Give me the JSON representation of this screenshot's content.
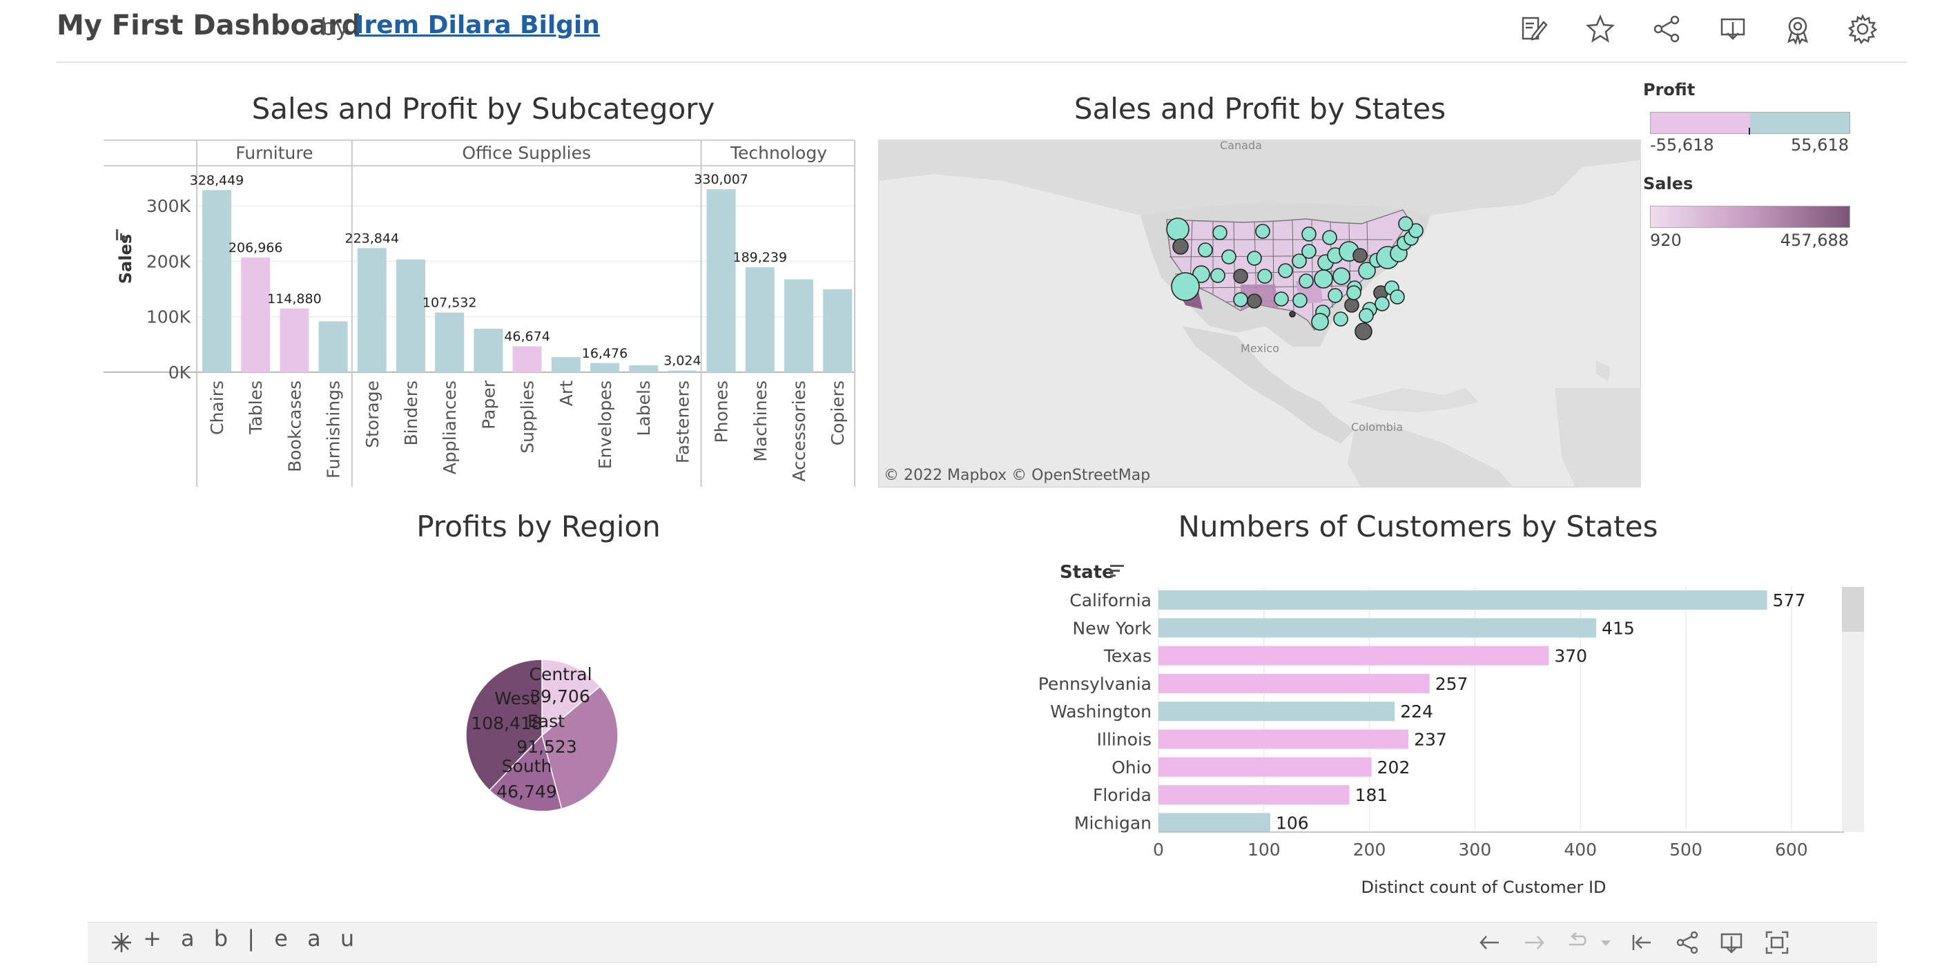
{
  "header": {
    "title": "My First Dashboard",
    "by": "by",
    "author": "Irem Dilara Bilgin",
    "icons": [
      "edit-icon",
      "star-icon",
      "share-icon",
      "download-icon",
      "metrics-icon",
      "settings-icon"
    ]
  },
  "colors": {
    "teal": "#b7d3da",
    "pink": "#e8c4e8",
    "bright_pink": "#eeb8ea",
    "mauve": "#8a5d86",
    "dark_mauve": "#6e3d68",
    "mint": "#8ee3cf"
  },
  "subcategory_chart": {
    "title": "Sales and Profit by Subcategory",
    "ylabel": "Sales",
    "yticks": [
      "300K",
      "200K",
      "100K",
      "0K"
    ],
    "groups": [
      {
        "name": "Furniture",
        "bars": [
          {
            "label": "Chairs",
            "value": 328449,
            "text": "328,449",
            "color": "teal"
          },
          {
            "label": "Tables",
            "value": 206966,
            "text": "206,966",
            "color": "pink"
          },
          {
            "label": "Bookcases",
            "value": 114880,
            "text": "114,880",
            "color": "pink"
          },
          {
            "label": "Furnishings",
            "value": 91705,
            "text": "",
            "color": "teal"
          }
        ]
      },
      {
        "name": "Office Supplies",
        "bars": [
          {
            "label": "Storage",
            "value": 223844,
            "text": "223,844",
            "color": "teal"
          },
          {
            "label": "Binders",
            "value": 203413,
            "text": "",
            "color": "teal"
          },
          {
            "label": "Appliances",
            "value": 107532,
            "text": "107,532",
            "color": "teal"
          },
          {
            "label": "Paper",
            "value": 78479,
            "text": "",
            "color": "teal"
          },
          {
            "label": "Supplies",
            "value": 46674,
            "text": "46,674",
            "color": "pink"
          },
          {
            "label": "Art",
            "value": 27119,
            "text": "",
            "color": "teal"
          },
          {
            "label": "Envelopes",
            "value": 16476,
            "text": "16,476",
            "color": "teal"
          },
          {
            "label": "Labels",
            "value": 12486,
            "text": "",
            "color": "teal"
          },
          {
            "label": "Fasteners",
            "value": 3024,
            "text": "3,024",
            "color": "teal"
          }
        ]
      },
      {
        "name": "Technology",
        "bars": [
          {
            "label": "Phones",
            "value": 330007,
            "text": "330,007",
            "color": "teal"
          },
          {
            "label": "Machines",
            "value": 189239,
            "text": "189,239",
            "color": "teal"
          },
          {
            "label": "Accessories",
            "value": 167380,
            "text": "",
            "color": "teal"
          },
          {
            "label": "Copiers",
            "value": 149528,
            "text": "",
            "color": "teal"
          }
        ]
      }
    ]
  },
  "map_chart": {
    "title": "Sales and Profit by States",
    "labels": {
      "canada": "Canada",
      "mexico": "Mexico",
      "colombia": "Colombia"
    },
    "attribution": "© 2022 Mapbox  © OpenStreetMap"
  },
  "legend": {
    "profit_title": "Profit",
    "profit_min": "-55,618",
    "profit_max": "55,618",
    "sales_title": "Sales",
    "sales_min": "920",
    "sales_max": "457,688"
  },
  "pie_chart": {
    "title": "Profits by Region",
    "slices": [
      {
        "region": "Central",
        "value": 39706,
        "text": "39,706",
        "color": "#e9cbe6"
      },
      {
        "region": "East",
        "value": 91523,
        "text": "91,523",
        "color": "#b27fab"
      },
      {
        "region": "South",
        "value": 46749,
        "text": "46,749",
        "color": "#9c6796"
      },
      {
        "region": "West",
        "value": 108418,
        "text": "108,418",
        "color": "#744a70"
      }
    ]
  },
  "customers_chart": {
    "title": "Numbers of Customers by States",
    "column_header": "State",
    "xlabel": "Distinct count of Customer ID",
    "xticks": [
      0,
      100,
      200,
      300,
      400,
      500,
      600
    ],
    "xlim": [
      0,
      650
    ],
    "bars": [
      {
        "state": "California",
        "value": 577,
        "color": "teal"
      },
      {
        "state": "New York",
        "value": 415,
        "color": "teal"
      },
      {
        "state": "Texas",
        "value": 370,
        "color": "bright_pink"
      },
      {
        "state": "Pennsylvania",
        "value": 257,
        "color": "bright_pink"
      },
      {
        "state": "Washington",
        "value": 224,
        "color": "teal"
      },
      {
        "state": "Illinois",
        "value": 237,
        "color": "bright_pink"
      },
      {
        "state": "Ohio",
        "value": 202,
        "color": "bright_pink"
      },
      {
        "state": "Florida",
        "value": 181,
        "color": "bright_pink"
      },
      {
        "state": "Michigan",
        "value": 106,
        "color": "teal"
      }
    ]
  },
  "footer": {
    "brand": "+ a b | e a u",
    "icons": [
      "undo-icon",
      "redo-icon",
      "revert-icon",
      "reset-icon",
      "share-icon",
      "download-icon",
      "fullscreen-icon"
    ]
  }
}
